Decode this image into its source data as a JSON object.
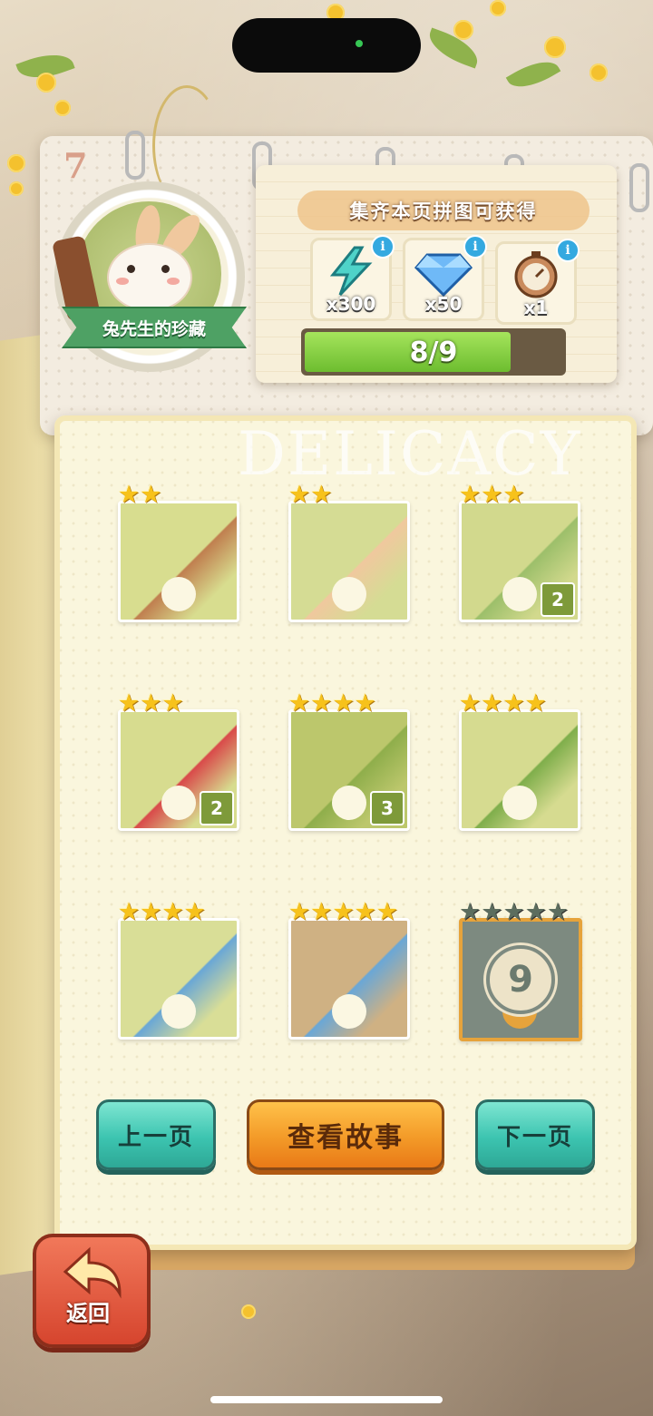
{
  "page": {
    "number": "7",
    "watermark": "DELICACY"
  },
  "collection": {
    "name": "兔先生的珍藏"
  },
  "reward": {
    "title": "集齐本页拼图可获得",
    "items": [
      {
        "icon": "lightning-icon",
        "qty": "x300"
      },
      {
        "icon": "diamond-icon",
        "qty": "x50"
      },
      {
        "icon": "stopwatch-icon",
        "qty": "x1"
      }
    ],
    "info_label": "i",
    "progress_text": "8/9",
    "progress_value": 0.889
  },
  "pieces": [
    {
      "stars": 2,
      "count": ""
    },
    {
      "stars": 2,
      "count": ""
    },
    {
      "stars": 3,
      "count": "2"
    },
    {
      "stars": 3,
      "count": "2"
    },
    {
      "stars": 4,
      "count": "3"
    },
    {
      "stars": 4,
      "count": ""
    },
    {
      "stars": 4,
      "count": ""
    },
    {
      "stars": 5,
      "count": ""
    },
    {
      "stars": 5,
      "count": "",
      "locked": true,
      "lock_number": "9"
    }
  ],
  "buttons": {
    "prev": "上一页",
    "story": "查看故事",
    "next": "下一页",
    "back": "返回"
  },
  "colors": {
    "star_on": "#f7c21b",
    "star_off": "#5c6d5e",
    "teal": "#3cc4b0",
    "orange": "#f39a28",
    "back": "#d6452e"
  }
}
